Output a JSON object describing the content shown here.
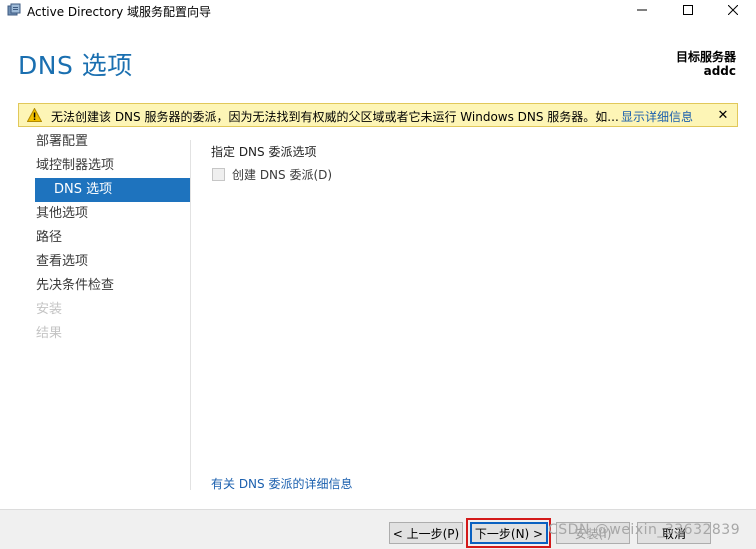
{
  "window": {
    "title": "Active Directory 域服务配置向导",
    "app_icon": "server-manager-icon",
    "controls": {
      "minimize": "minimize-icon",
      "maximize": "maximize-icon",
      "close": "close-icon"
    }
  },
  "header": {
    "page_title": "DNS 选项",
    "target_server_label": "目标服务器",
    "target_server_name": "addc"
  },
  "warning": {
    "icon": "warning-icon",
    "message": "无法创建该 DNS 服务器的委派，因为无法找到有权威的父区域或者它未运行 Windows DNS 服务器。如...",
    "details_link": "显示详细信息",
    "close_glyph": "✕"
  },
  "nav": {
    "items": [
      {
        "label": "部署配置",
        "state": "normal"
      },
      {
        "label": "域控制器选项",
        "state": "normal"
      },
      {
        "label": "DNS 选项",
        "state": "selected"
      },
      {
        "label": "其他选项",
        "state": "normal"
      },
      {
        "label": "路径",
        "state": "normal"
      },
      {
        "label": "查看选项",
        "state": "normal"
      },
      {
        "label": "先决条件检查",
        "state": "normal"
      },
      {
        "label": "安装",
        "state": "disabled"
      },
      {
        "label": "结果",
        "state": "disabled"
      }
    ]
  },
  "content": {
    "section_label": "指定 DNS 委派选项",
    "checkbox_create_delegation": {
      "label": "创建 DNS 委派(D)",
      "checked": false,
      "enabled": false
    },
    "more_info_link": "有关 DNS 委派的详细信息"
  },
  "footer": {
    "prev_label": "< 上一步(P)",
    "next_label": "下一步(N) >",
    "install_label": "安装(I)",
    "cancel_label": "取消",
    "watermark": "CSDN @weixin_33632839"
  },
  "colors": {
    "title_blue": "#1a6fb0",
    "nav_selected": "#1e73be",
    "warning_bg": "#fdf5b6",
    "link": "#1a5fae",
    "highlight_red": "#d31a1a"
  }
}
